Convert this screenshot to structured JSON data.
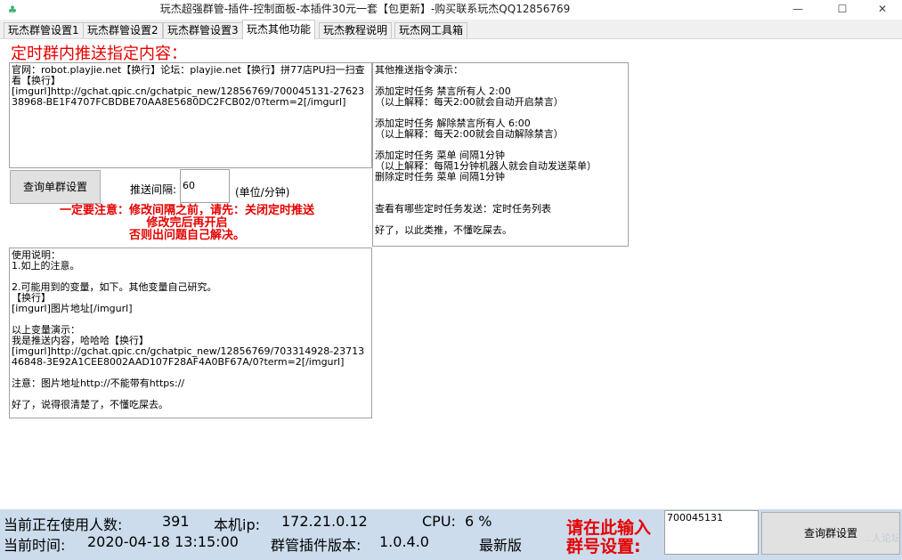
{
  "window": {
    "title": "玩杰超强群管-插件-控制面板-本插件30元一套【包更新】-购买联系玩杰QQ12856769",
    "minimize": "—",
    "maximize": "☐",
    "close": "✕"
  },
  "tabs": [
    {
      "label": "玩杰群管设置1"
    },
    {
      "label": "玩杰群管设置2"
    },
    {
      "label": "玩杰群管设置3"
    },
    {
      "label": "玩杰其他功能"
    },
    {
      "label": "玩杰教程说明"
    },
    {
      "label": "玩杰网工具箱"
    }
  ],
  "active_tab": "玩杰其他功能",
  "main": {
    "heading": "定时群内推送指定内容：",
    "push_content": "官网：robot.playjie.net【换行】论坛：playjie.net【换行】拼77店PU扫一扫查看【换行】\n[imgurl]http://gchat.qpic.cn/gchatpic_new/12856769/700045131-2762338968-BE1F4707FCBDBE70AA8E5680DC2FCB02/0?term=2[/imgurl]",
    "commands_demo": "其他推送指令演示：\n\n添加定时任务 禁言所有人 2:00\n（以上解释：每天2:00就会自动开启禁言）\n\n添加定时任务 解除禁言所有人 6:00\n（以上解释：每天2:00就会自动解除禁言）\n\n添加定时任务 菜单 间隔1分钟\n（以上解释：每隔1分钟机器人就会自动发送菜单）\n删除定时任务 菜单 间隔1分钟\n\n\n查看有哪些定时任务发送：定时任务列表\n\n好了，以此类推，不懂吃屎去。",
    "query_button": "查询单群设置",
    "interval_label": "推送间隔:",
    "interval_value": "60",
    "interval_unit": "(单位/分钟)",
    "warning_line1": "一定要注意：修改间隔之前，请先：关闭定时推送",
    "warning_line2": "修改完后再开启",
    "warning_line3": "否则出问题自己解决。",
    "usage_text": "使用说明：\n1.如上的注意。\n\n2.可能用到的变量，如下。其他变量自己研究。\n【换行】\n[imgurl]图片地址[/imgurl]\n\n以上变量演示：\n我是推送内容，哈哈哈【换行】\n[imgurl]http://gchat.qpic.cn/gchatpic_new/12856769/703314928-2371346848-3E92A1CEE8002AAD107F28AF4A0BF67A/0?term=2[/imgurl]\n\n注意：图片地址http://不能带有https://\n\n好了，说得很清楚了，不懂吃屎去。"
  },
  "status": {
    "users_label": "当前正在使用人数:",
    "users_value": "391",
    "ip_label": "本机ip:",
    "ip_value": "172.21.0.12",
    "cpu_label": "CPU:",
    "cpu_value": "6 %",
    "time_label": "当前时间:",
    "time_value": "2020-04-18 13:15:00",
    "version_label": "群管插件版本:",
    "version_value": "1.0.4.0",
    "latest_label": "最新版",
    "prompt_line1": "请在此输入",
    "prompt_line2": "群号设置:",
    "group_number": "700045131",
    "query_button": "查询群设置",
    "watermark": "..人论坛"
  },
  "colors": {
    "accent_red": "#e60000",
    "status_bg": "#ccdcec"
  }
}
